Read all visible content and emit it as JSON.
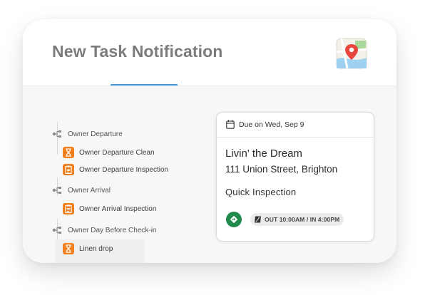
{
  "header": {
    "title": "New Task Notification",
    "map_icon": "map-pin-icon",
    "tab_indicator_color": "#3f9adf"
  },
  "task_tree": {
    "groups": [
      {
        "label": "Owner Departure",
        "icon": "hierarchy-icon",
        "tasks": [
          {
            "label": "Owner Departure Clean",
            "icon": "hourglass-icon"
          },
          {
            "label": "Owner Departure Inspection",
            "icon": "clipboard-icon"
          }
        ]
      },
      {
        "label": "Owner Arrival",
        "icon": "hierarchy-icon",
        "tasks": [
          {
            "label": "Owner Arrival Inspection",
            "icon": "clipboard-icon"
          }
        ]
      },
      {
        "label": "Owner Day Before Check-in",
        "icon": "hierarchy-icon",
        "tasks": [
          {
            "label": "Linen drop",
            "icon": "hourglass-icon"
          }
        ]
      }
    ],
    "task_badge_color": "#f2801f"
  },
  "task_card": {
    "due": "Due on Wed, Sep 9",
    "property_name": "Livin' the Dream",
    "address": "111 Union Street, Brighton",
    "task_type": "Quick Inspection",
    "times": "OUT 10:00AM / IN 4:00PM",
    "navigate_color": "#1f8a4c"
  }
}
